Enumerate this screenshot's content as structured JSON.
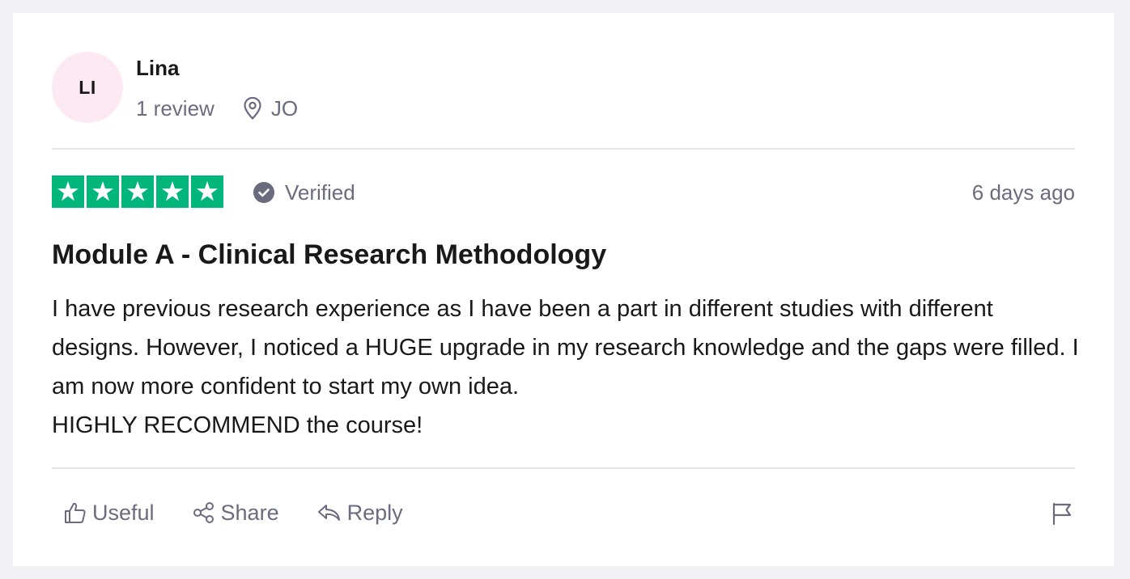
{
  "reviewer": {
    "initials": "LI",
    "name": "Lina",
    "review_count": "1 review",
    "location": "JO",
    "avatar_color": "#fce9f1",
    "location_icon": "location-pin-icon"
  },
  "rating": {
    "stars": 5,
    "max": 5,
    "star_color": "#00b67a",
    "verified_label": "Verified",
    "date": "6 days ago"
  },
  "review": {
    "title": "Module A - Clinical Research Methodology",
    "body_lines": [
      "I have previous research experience as I have been a part in different studies with different designs. However, I noticed a HUGE upgrade in my research knowledge and the gaps were filled. I am now more confident to start my own idea.",
      "HIGHLY RECOMMEND the course!"
    ]
  },
  "actions": {
    "useful_label": "Useful",
    "share_label": "Share",
    "reply_label": "Reply",
    "flag_icon": "flag-icon"
  },
  "colors": {
    "muted_text": "#6b6b80",
    "text": "#191919",
    "background": "#f1f1f3"
  }
}
